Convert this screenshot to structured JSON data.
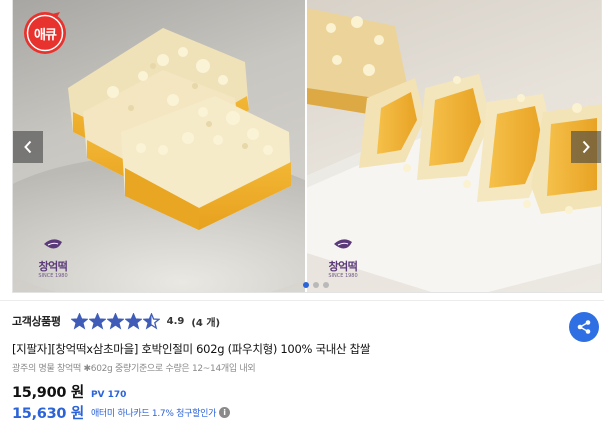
{
  "badge": {
    "text": "애큐",
    "icon": "sale-sticker-icon"
  },
  "carousel": {
    "brand_left": {
      "name": "창억떡",
      "sub": "SINCE 1980"
    },
    "brand_right": {
      "name": "창억떡",
      "sub": "SINCE 1980"
    },
    "prev_icon": "chevron-left-icon",
    "next_icon": "chevron-right-icon",
    "slide_count": 3,
    "active_slide": 0
  },
  "rating": {
    "label": "고객상품평",
    "score": "4.9",
    "count": "(4 개)",
    "stars_value": 4.5,
    "stars_max": 5
  },
  "product": {
    "title": "[지팔자][창억떡x삼초마을] 호박인절미 602g (파우치형) 100% 국내산 찹쌀",
    "subtitle": "광주의 명물 창억떡 ✱602g 중량기준으로 수량은 12~14개입 내외"
  },
  "price": {
    "amount": "15,900 원",
    "pv": "PV 170",
    "card_amount": "15,630 원",
    "card_desc": "애터미 하나카드 1.7% 청구할인가",
    "info_icon": "i"
  },
  "colors": {
    "accent": "#2b63d9",
    "share": "#2f6fe4",
    "star": "#3f5db8",
    "sticker": "#e8322d",
    "brand": "#5b3a7a"
  },
  "share_icon": "share-icon"
}
